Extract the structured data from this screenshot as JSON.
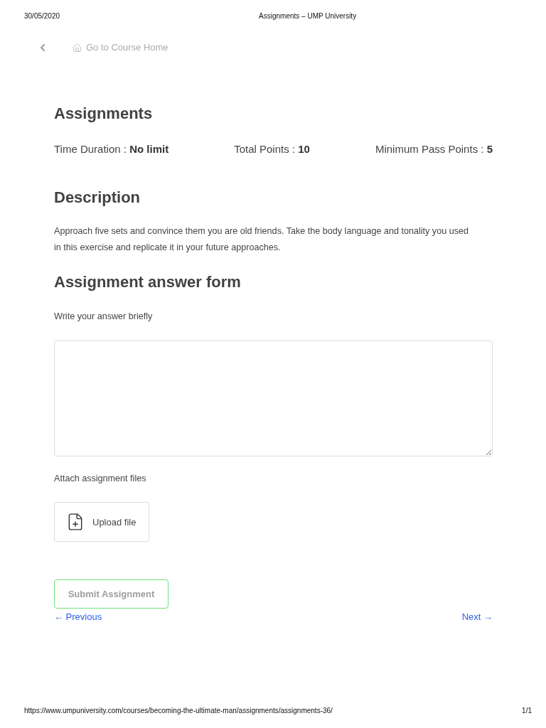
{
  "print_header": {
    "date": "30/05/2020",
    "title": "Assignments – UMP University"
  },
  "nav": {
    "home_link": "Go to Course Home"
  },
  "assignment": {
    "title": "Assignments",
    "meta": [
      "Time Duration : **No limit**",
      "Total Points : **10**",
      "Minimum Pass Points : **5**"
    ]
  },
  "description": {
    "heading": "Description",
    "text": "Approach five sets and convince them you are old friends. Take the body language and tonality you used in this exercise and replicate it in your future approaches."
  },
  "answer_form": {
    "heading": "Assignment answer form",
    "answer_label": "Write your answer briefly",
    "attach_label": "Attach assignment files",
    "upload_button": "Upload file",
    "submit_button": "Submit Assignment"
  },
  "pagination": {
    "previous": "← Previous",
    "next": "Next →"
  },
  "print_footer": {
    "url": "https://www.umpuniversity.com/courses/becoming-the-ultimate-man/assignments/assignments-36/",
    "page": "1/1"
  }
}
